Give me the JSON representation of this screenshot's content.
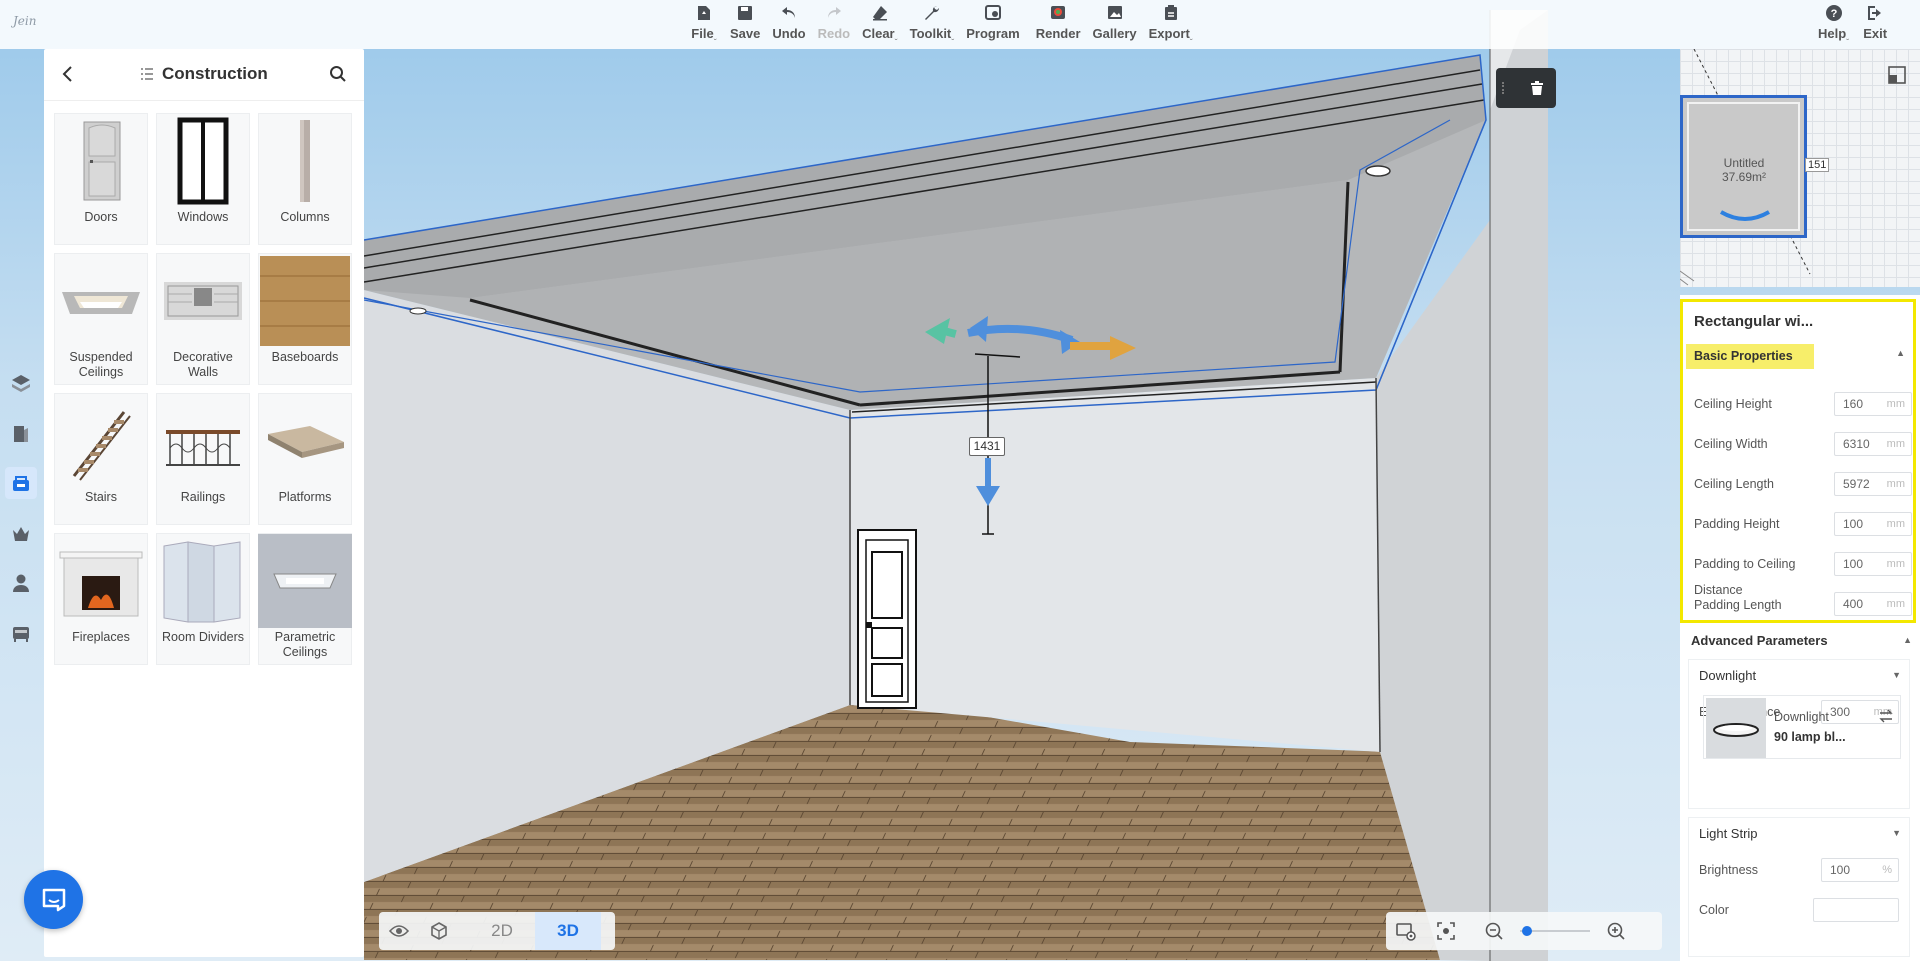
{
  "app": {
    "logo_text": "Jein"
  },
  "toolbar": {
    "center": [
      {
        "label": "File",
        "caret": "ˬ",
        "icon": "file-icon",
        "enabled": true
      },
      {
        "label": "Save",
        "caret": "",
        "icon": "save-icon",
        "enabled": true
      },
      {
        "label": "Undo",
        "caret": "",
        "icon": "undo-icon",
        "enabled": true
      },
      {
        "label": "Redo",
        "caret": "",
        "icon": "redo-icon",
        "enabled": false
      },
      {
        "label": "Clear",
        "caret": "ˬ",
        "icon": "eraser-icon",
        "enabled": true
      },
      {
        "label": "Toolkit",
        "caret": "ˬ",
        "icon": "wrench-icon",
        "enabled": true
      },
      {
        "label": "Program",
        "caret": "",
        "icon": "program-icon",
        "enabled": true
      },
      {
        "label": "Render",
        "caret": "",
        "icon": "render-icon",
        "enabled": true
      },
      {
        "label": "Gallery",
        "caret": "",
        "icon": "gallery-icon",
        "enabled": true
      },
      {
        "label": "Export",
        "caret": "ˬ",
        "icon": "export-icon",
        "enabled": true
      }
    ],
    "right": [
      {
        "label": "Help",
        "caret": "ˬ",
        "icon": "help-icon"
      },
      {
        "label": "Exit",
        "caret": "",
        "icon": "exit-icon"
      }
    ]
  },
  "rail": [
    {
      "icon": "layers-icon",
      "active": false
    },
    {
      "icon": "room-icon",
      "active": false
    },
    {
      "icon": "construction-icon",
      "active": true
    },
    {
      "icon": "crown-icon",
      "active": false
    },
    {
      "icon": "user-icon",
      "active": false
    },
    {
      "icon": "furniture-icon",
      "active": false
    }
  ],
  "catalog": {
    "title": "Construction",
    "items": [
      {
        "label": "Doors",
        "icon": "door-icon"
      },
      {
        "label": "Windows",
        "icon": "window-icon"
      },
      {
        "label": "Columns",
        "icon": "column-icon"
      },
      {
        "label": "Suspended Ceilings",
        "icon": "suspended-ceiling-icon"
      },
      {
        "label": "Decorative Walls",
        "icon": "decorative-wall-icon"
      },
      {
        "label": "Baseboards",
        "icon": "baseboard-icon"
      },
      {
        "label": "Stairs",
        "icon": "stairs-icon"
      },
      {
        "label": "Railings",
        "icon": "railing-icon"
      },
      {
        "label": "Platforms",
        "icon": "platform-icon"
      },
      {
        "label": "Fireplaces",
        "icon": "fireplace-icon"
      },
      {
        "label": "Room Dividers",
        "icon": "room-divider-icon"
      },
      {
        "label": "Parametric Ceilings",
        "icon": "parametric-ceiling-icon"
      }
    ]
  },
  "viewport": {
    "height_label": "1431",
    "view_modes": [
      "2D",
      "3D"
    ],
    "active_mode": "3D",
    "zoom_level": 0.1
  },
  "minimap": {
    "room_name": "Untitled",
    "room_area": "37.69m²",
    "dimension": "151"
  },
  "properties": {
    "title": "Rectangular wi...",
    "basic_header": "Basic Properties",
    "basic": [
      {
        "label": "Ceiling Height",
        "value": "160",
        "unit": "mm"
      },
      {
        "label": "Ceiling Width",
        "value": "6310",
        "unit": "mm"
      },
      {
        "label": "Ceiling Length",
        "value": "5972",
        "unit": "mm"
      },
      {
        "label": "Padding Height",
        "value": "100",
        "unit": "mm"
      },
      {
        "label": "Padding to Ceiling",
        "value": "100",
        "unit": "mm"
      },
      {
        "label": "Distance\nPadding Length",
        "value": "400",
        "unit": "mm"
      }
    ],
    "advanced_header": "Advanced Parameters",
    "downlight": {
      "header": "Downlight",
      "edge_label": "Edge Distance",
      "edge_value": "300",
      "edge_unit": "mm",
      "card_line1": "Downlight",
      "card_line2": "90 lamp bl..."
    },
    "light_strip": {
      "header": "Light Strip",
      "brightness_label": "Brightness",
      "brightness_value": "100",
      "brightness_unit": "%",
      "color_label": "Color"
    }
  },
  "colors": {
    "accent": "#1f73e6",
    "highlight_border": "#f3e800",
    "selection_line": "#2d66c8"
  }
}
